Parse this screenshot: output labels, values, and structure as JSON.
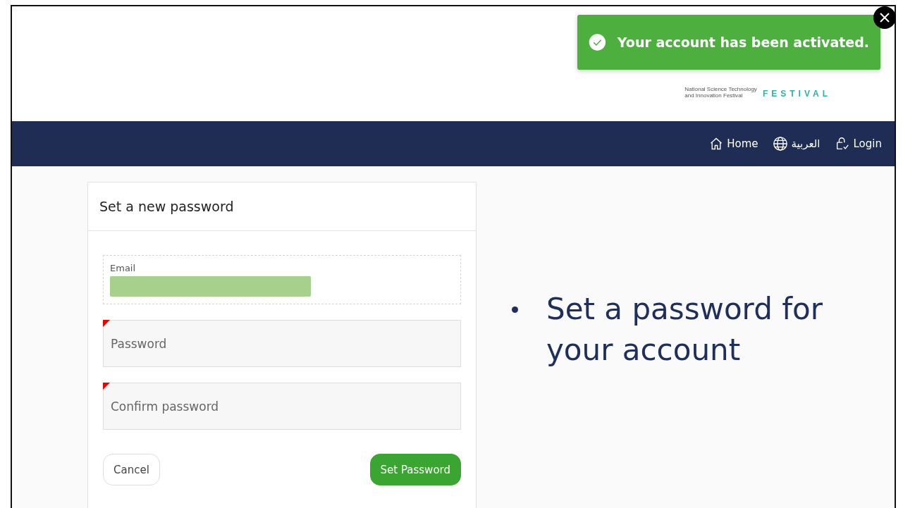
{
  "toast": {
    "message": "Your account has been activated."
  },
  "logo": {
    "lines": [
      "National Science Technology",
      "and Innovation Festival"
    ],
    "wordmark": "FESTIVAL"
  },
  "nav": {
    "items": [
      {
        "kind": "home",
        "label": "Home"
      },
      {
        "kind": "language",
        "label": "العربية"
      },
      {
        "kind": "login",
        "label": "Login"
      }
    ]
  },
  "form": {
    "title": "Set a new password",
    "fields": [
      {
        "kind": "readonly",
        "label": "Email",
        "redacted": true,
        "required": false
      },
      {
        "kind": "password",
        "placeholder": "Password",
        "required": true
      },
      {
        "kind": "password",
        "placeholder": "Confirm password",
        "required": true
      }
    ],
    "buttons": [
      {
        "kind": "secondary",
        "label": "Cancel"
      },
      {
        "kind": "primary",
        "label": "Set Password"
      }
    ]
  },
  "bullets": [
    "Set a password for your account"
  ]
}
